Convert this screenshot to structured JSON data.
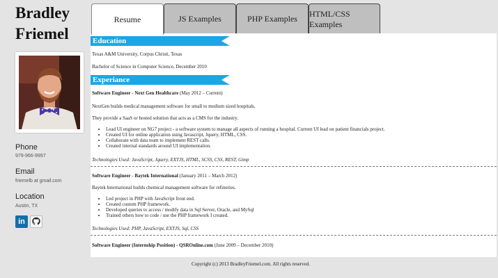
{
  "profile": {
    "first_name": "Bradley",
    "last_name": "Friemel",
    "phone_label": "Phone",
    "phone": "979-966-9997",
    "email_label": "Email",
    "email": "friemelb at gmail.com",
    "location_label": "Location",
    "location": "Austin, TX"
  },
  "social": {
    "linkedin_text": "in"
  },
  "tabs": [
    {
      "label": "Resume",
      "active": true
    },
    {
      "label": "JS Examples",
      "active": false
    },
    {
      "label": "PHP Examples",
      "active": false
    },
    {
      "label": "HTML/CSS Examples",
      "active": false
    }
  ],
  "education": {
    "heading": "Education",
    "school": "Texas A&M University, Corpus Christi, Texas",
    "degree": "Bachelor of Science in Computer Science, December 2010"
  },
  "experience": {
    "heading": "Experiance",
    "jobs": [
      {
        "title": "Software Engineer - Next Gen Healthcare",
        "dates": "(May 2012 – Current)",
        "desc1": "NextGen builds medical management software for small to medium sized hospitals.",
        "desc2": "They provide a SaaS or hosted solution that acts as a CMS for the industry.",
        "bullets": [
          "Lead UI engineer on NG7 project - a software system to manage all aspects of running a hospital. Current UI lead on patient financials project.",
          "Created UI for online application using Javascript, Jquery, HTML, CSS.",
          "Collaborate with data team to implement REST calls.",
          "Created internal standards around UI implementation."
        ],
        "tech": "Technologies Used: JavaScript, Jquery, EXTJS, HTML, SCSS, CSS, REST, Gimp"
      },
      {
        "title": "Software Engineer - Baytek International",
        "dates": "(January 2011 – March 2012)",
        "desc1": "Baytek International builds chemical management software for refineries.",
        "bullets": [
          "Led project in PHP with JavaScript front end.",
          "Created custom PHP framework.",
          "Developed queries to access / modify data in Sql Server, Oracle, and MySql",
          "Trained others how to code / use the PHP framework I created."
        ],
        "tech": "Technologies Used: PHP, JavaScript, EXTJS, Sql, CSS"
      },
      {
        "title": "Software Engineer (Internship Position) - QSROnline.com",
        "dates": "(June 2009 – December 2010)"
      }
    ]
  },
  "footer": "Copyright (c) 2013 BradleyFriemel.com. All rights reserved.",
  "colors": {
    "banner": "#1ba7e3",
    "background": "#e4e4e4",
    "tab_inactive": "#bfbfbf"
  }
}
